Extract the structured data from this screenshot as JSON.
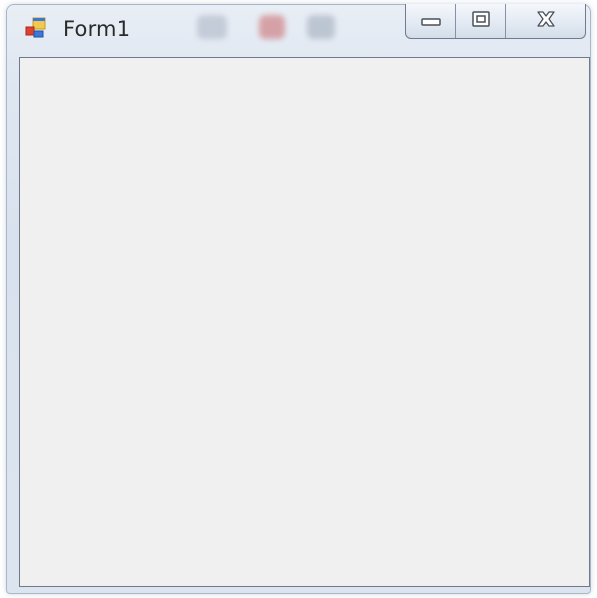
{
  "window": {
    "title": "Form1"
  },
  "titlebar": {
    "app_icon": "windows-form-icon",
    "buttons": [
      {
        "name": "minimize",
        "icon": "minimize-icon"
      },
      {
        "name": "maximize",
        "icon": "maximize-icon"
      },
      {
        "name": "close",
        "icon": "close-icon"
      }
    ]
  },
  "colors": {
    "client_background": "#f0f0f0",
    "frame": "#dce5ef"
  }
}
